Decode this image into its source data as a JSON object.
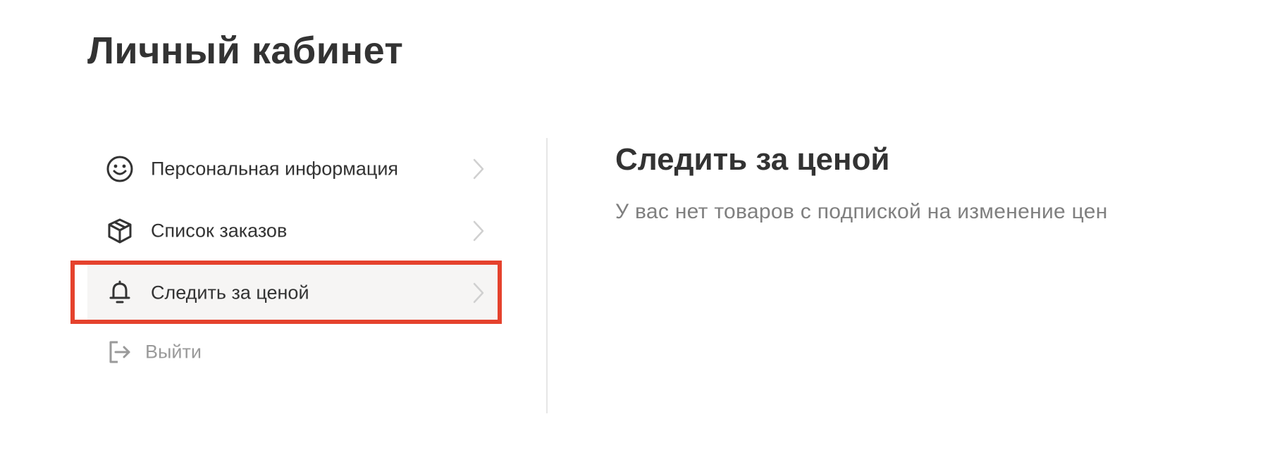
{
  "header": {
    "title": "Личный кабинет"
  },
  "sidebar": {
    "items": [
      {
        "label": "Персональная информация",
        "icon": "smile-icon",
        "active": false
      },
      {
        "label": "Список заказов",
        "icon": "box-icon",
        "active": false
      },
      {
        "label": "Следить за ценой",
        "icon": "bell-icon",
        "active": true
      }
    ],
    "logout": {
      "label": "Выйти",
      "icon": "logout-icon"
    }
  },
  "main": {
    "title": "Следить за ценой",
    "empty_message": "У вас нет товаров с подпиской на изменение цен"
  },
  "colors": {
    "text_primary": "#333333",
    "text_muted": "#7f7f7f",
    "logout_text": "#9a9a9a",
    "active_background": "#f6f5f4",
    "highlight_border": "#e5422d",
    "divider": "#e6e6e6"
  }
}
